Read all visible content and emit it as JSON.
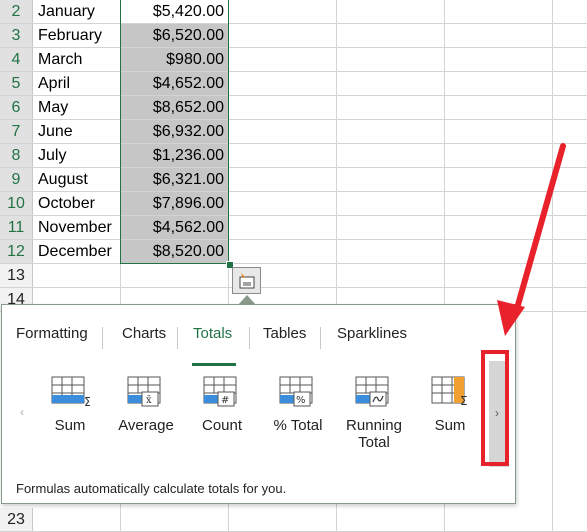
{
  "rows": [
    {
      "num": "2",
      "month": "January",
      "value": "$5,420.00",
      "shaded": false
    },
    {
      "num": "3",
      "month": "February",
      "value": "$6,520.00",
      "shaded": true
    },
    {
      "num": "4",
      "month": "March",
      "value": "$980.00",
      "shaded": true
    },
    {
      "num": "5",
      "month": "April",
      "value": "$4,652.00",
      "shaded": true
    },
    {
      "num": "6",
      "month": "May",
      "value": "$8,652.00",
      "shaded": true
    },
    {
      "num": "7",
      "month": "June",
      "value": "$6,932.00",
      "shaded": true
    },
    {
      "num": "8",
      "month": "July",
      "value": "$1,236.00",
      "shaded": true
    },
    {
      "num": "9",
      "month": "August",
      "value": "$6,321.00",
      "shaded": true
    },
    {
      "num": "10",
      "month": "October",
      "value": "$7,896.00",
      "shaded": true
    },
    {
      "num": "11",
      "month": "November",
      "value": "$4,562.00",
      "shaded": true
    },
    {
      "num": "12",
      "month": "December",
      "value": "$8,520.00",
      "shaded": true
    }
  ],
  "empty_rows": [
    "13",
    "14",
    "23"
  ],
  "quick_analysis": {
    "tabs": [
      "Formatting",
      "Charts",
      "Totals",
      "Tables",
      "Sparklines"
    ],
    "active_tab": "Totals",
    "options": [
      "Sum",
      "Average",
      "Count",
      "% Total",
      "Running Total",
      "Sum"
    ],
    "footer": "Formulas automatically calculate totals for you.",
    "scroll_left": "‹",
    "scroll_right": "›"
  },
  "colors": {
    "accent": "#217346",
    "annotation": "#e8212a",
    "selection_fill": "#c6c6c6"
  }
}
